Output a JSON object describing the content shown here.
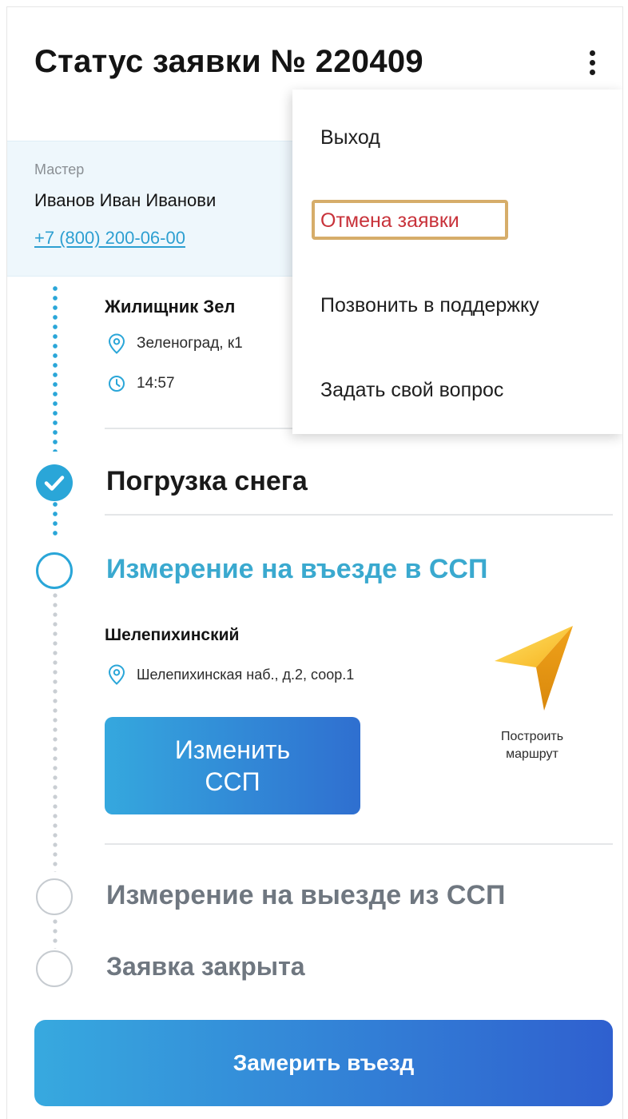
{
  "header": {
    "title": "Статус заявки № 220409",
    "menu_icon": "more-vertical-icon"
  },
  "master": {
    "caption": "Мастер",
    "name": "Иванов Иван Иванови",
    "phone": "+7 (800) 200-06-00"
  },
  "pickup": {
    "title": "Жилищник Зел",
    "address": "Зеленоград, к1",
    "time": "14:57"
  },
  "steps": [
    {
      "label": "Погрузка снега",
      "state": "done"
    },
    {
      "label": "Измерение на въезде в ССП",
      "state": "active"
    },
    {
      "label": "Измерение на выезде из ССП",
      "state": "todo"
    },
    {
      "label": "Заявка закрыта",
      "state": "todo"
    }
  ],
  "ssp": {
    "name": "Шелепихинский",
    "address": "Шелепихинская наб., д.2, соор.1",
    "change_button": "Изменить\nССП",
    "route_label": "Построить\nмаршрут"
  },
  "main_button": "Замерить въезд",
  "menu": {
    "items": [
      "Выход",
      "Отмена заявки",
      "Позвонить в поддержку",
      "Задать свой вопрос"
    ]
  },
  "colors": {
    "accent": "#2aa6d8",
    "danger": "#c8323a",
    "highlight": "#d6ad6a",
    "gradient_start": "#37a9df",
    "gradient_end": "#2f60cf"
  }
}
